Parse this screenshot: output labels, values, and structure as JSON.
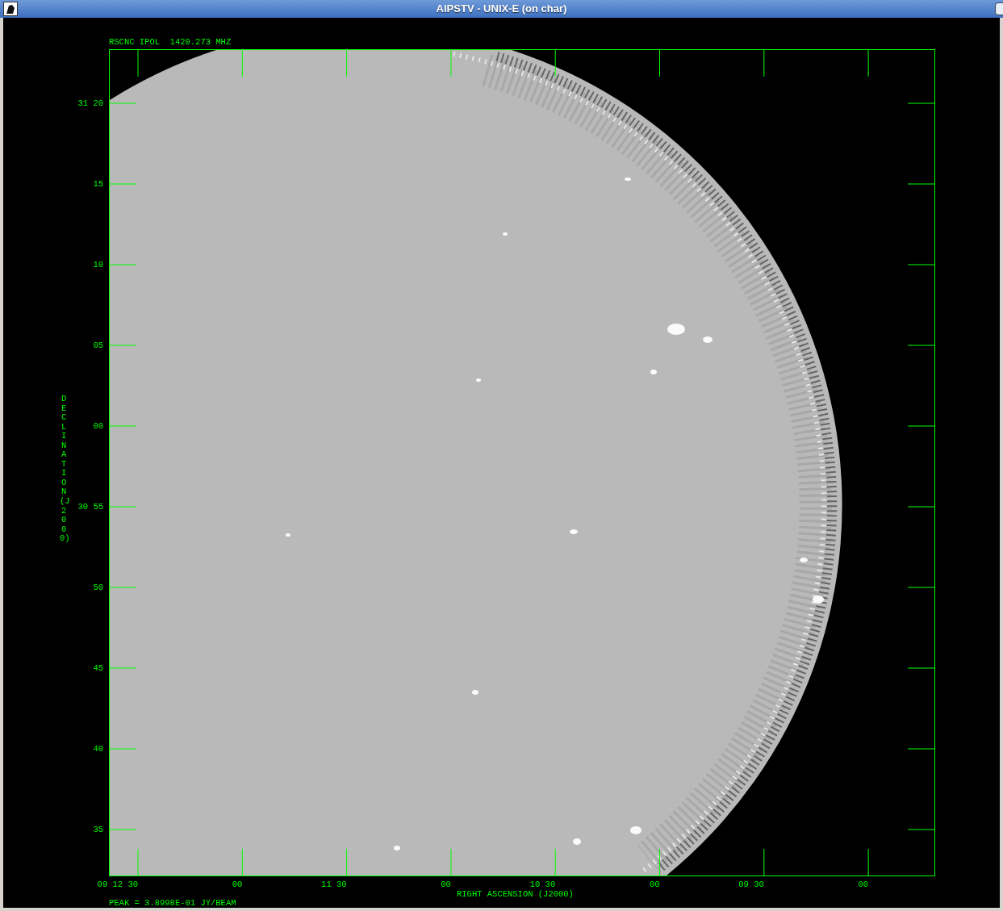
{
  "window": {
    "title": "AIPSTV - UNIX-E (on char)"
  },
  "plot": {
    "header": "RSCNC IPOL  1420.273 MHZ",
    "y_axis": {
      "title": "DECLINATION (J2000)",
      "ticks": [
        "31 20",
        "15",
        "10",
        "05",
        "00",
        "30 55",
        "50",
        "45",
        "40",
        "35"
      ]
    },
    "x_axis": {
      "title": "RIGHT ASCENSION (J2000)",
      "ticks": [
        "09 12 30",
        "00",
        "11 30",
        "00",
        "10 30",
        "00",
        "09 30",
        "00"
      ]
    },
    "footer": "PEAK = 3.8998E-01 JY/BEAM"
  }
}
